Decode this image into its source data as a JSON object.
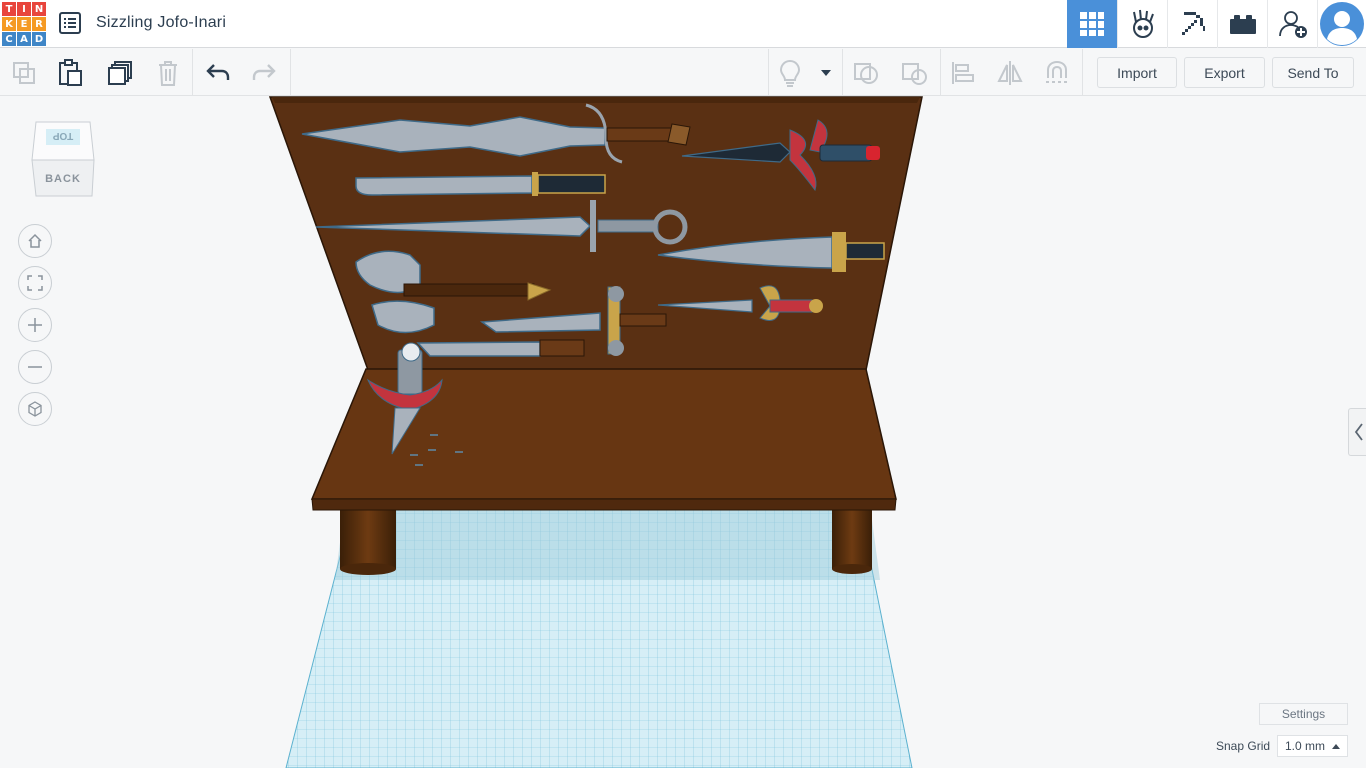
{
  "app": {
    "logo_letters": [
      "T",
      "I",
      "N",
      "K",
      "E",
      "R",
      "C",
      "A",
      "D"
    ],
    "logo_colors": [
      "#e8453c",
      "#e8453c",
      "#e8453c",
      "#f59a23",
      "#f59a23",
      "#f59a23",
      "#3f86c7",
      "#3f86c7",
      "#3f86c7"
    ],
    "design_title": "Sizzling Jofo-Inari",
    "accent_color": "#4a90d9"
  },
  "topbar": {
    "icons": [
      "grid-view-icon",
      "codeblocks-icon",
      "minecraft-pickaxe-icon",
      "bricks-icon",
      "add-user-icon",
      "avatar"
    ]
  },
  "toolbar": {
    "buttons": [
      "copy-icon",
      "paste-icon",
      "duplicate-icon",
      "delete-icon",
      "undo-icon",
      "redo-icon",
      "lightbulb-icon",
      "dropdown-icon",
      "group-icon",
      "ungroup-icon",
      "align-icon",
      "mirror-icon",
      "workplane-icon"
    ],
    "import_label": "Import",
    "export_label": "Export",
    "send_to_label": "Send To"
  },
  "viewcube": {
    "top_label": "TOP",
    "back_label": "BACK"
  },
  "nav": [
    "home-view-icon",
    "fit-view-icon",
    "zoom-in-icon",
    "zoom-out-icon",
    "ortho-view-icon"
  ],
  "footer": {
    "settings_label": "Settings",
    "snap_grid_label": "Snap Grid",
    "snap_grid_value": "1.0 mm"
  }
}
